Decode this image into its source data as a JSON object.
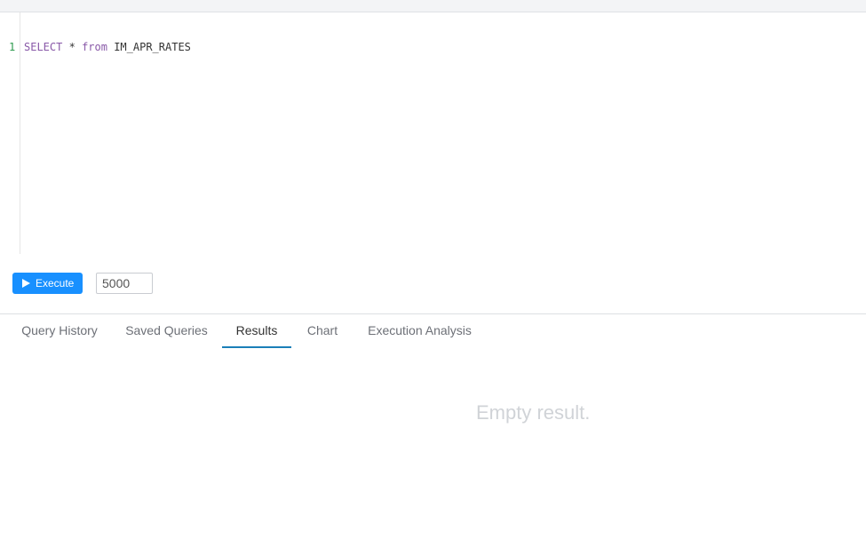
{
  "editor": {
    "line_number": "1",
    "sql_keyword_select": "SELECT",
    "sql_star": "*",
    "sql_keyword_from": "from",
    "sql_table": "IM_APR_RATES"
  },
  "toolbar": {
    "execute_label": "Execute",
    "limit_value": "5000"
  },
  "tabs": [
    {
      "label": "Query History"
    },
    {
      "label": "Saved Queries"
    },
    {
      "label": "Results",
      "active": true
    },
    {
      "label": "Chart"
    },
    {
      "label": "Execution Analysis"
    }
  ],
  "results": {
    "empty_message": "Empty result."
  },
  "colors": {
    "accent": "#1890ff",
    "active_tab_underline": "#1a7fb8",
    "keyword": "#8959a8",
    "line_number": "#2e9b4f"
  }
}
